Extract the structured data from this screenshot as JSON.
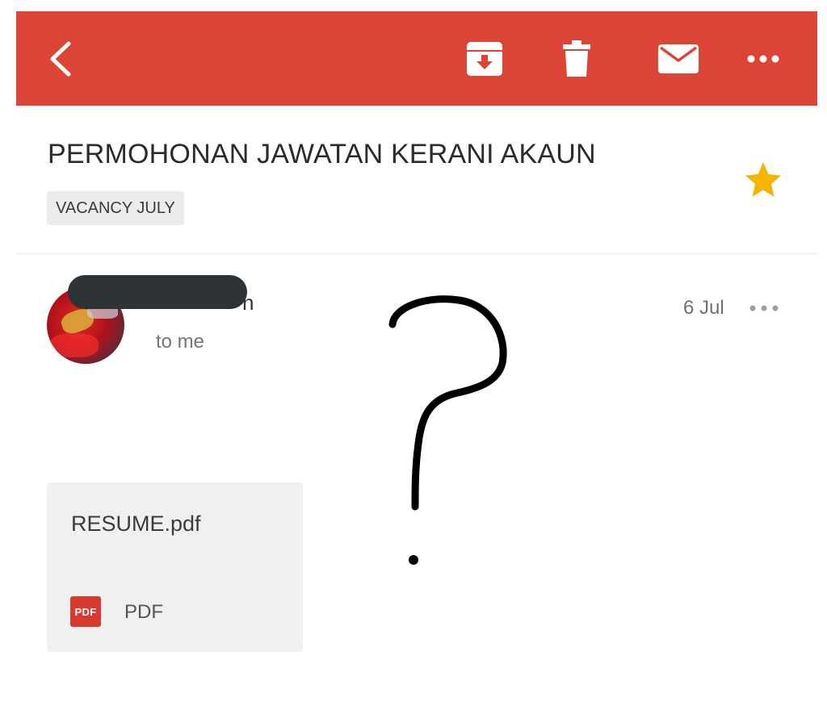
{
  "toolbar": {
    "background_color": "#dc4437",
    "icons": [
      "back-icon",
      "archive-icon",
      "delete-icon",
      "mark-unread-icon",
      "more-options-icon"
    ]
  },
  "message": {
    "subject": "PERMOHONAN JAWATAN KERANI AKAUN",
    "label": "VACANCY JULY",
    "starred": true,
    "star_color": "#f4b400",
    "sender_name_visible_tail": "n",
    "recipient": "to me",
    "date": "6 Jul"
  },
  "attachment": {
    "file_name": "RESUME.pdf",
    "badge": "PDF",
    "type_label": "PDF",
    "badge_color": "#d93a2f"
  }
}
